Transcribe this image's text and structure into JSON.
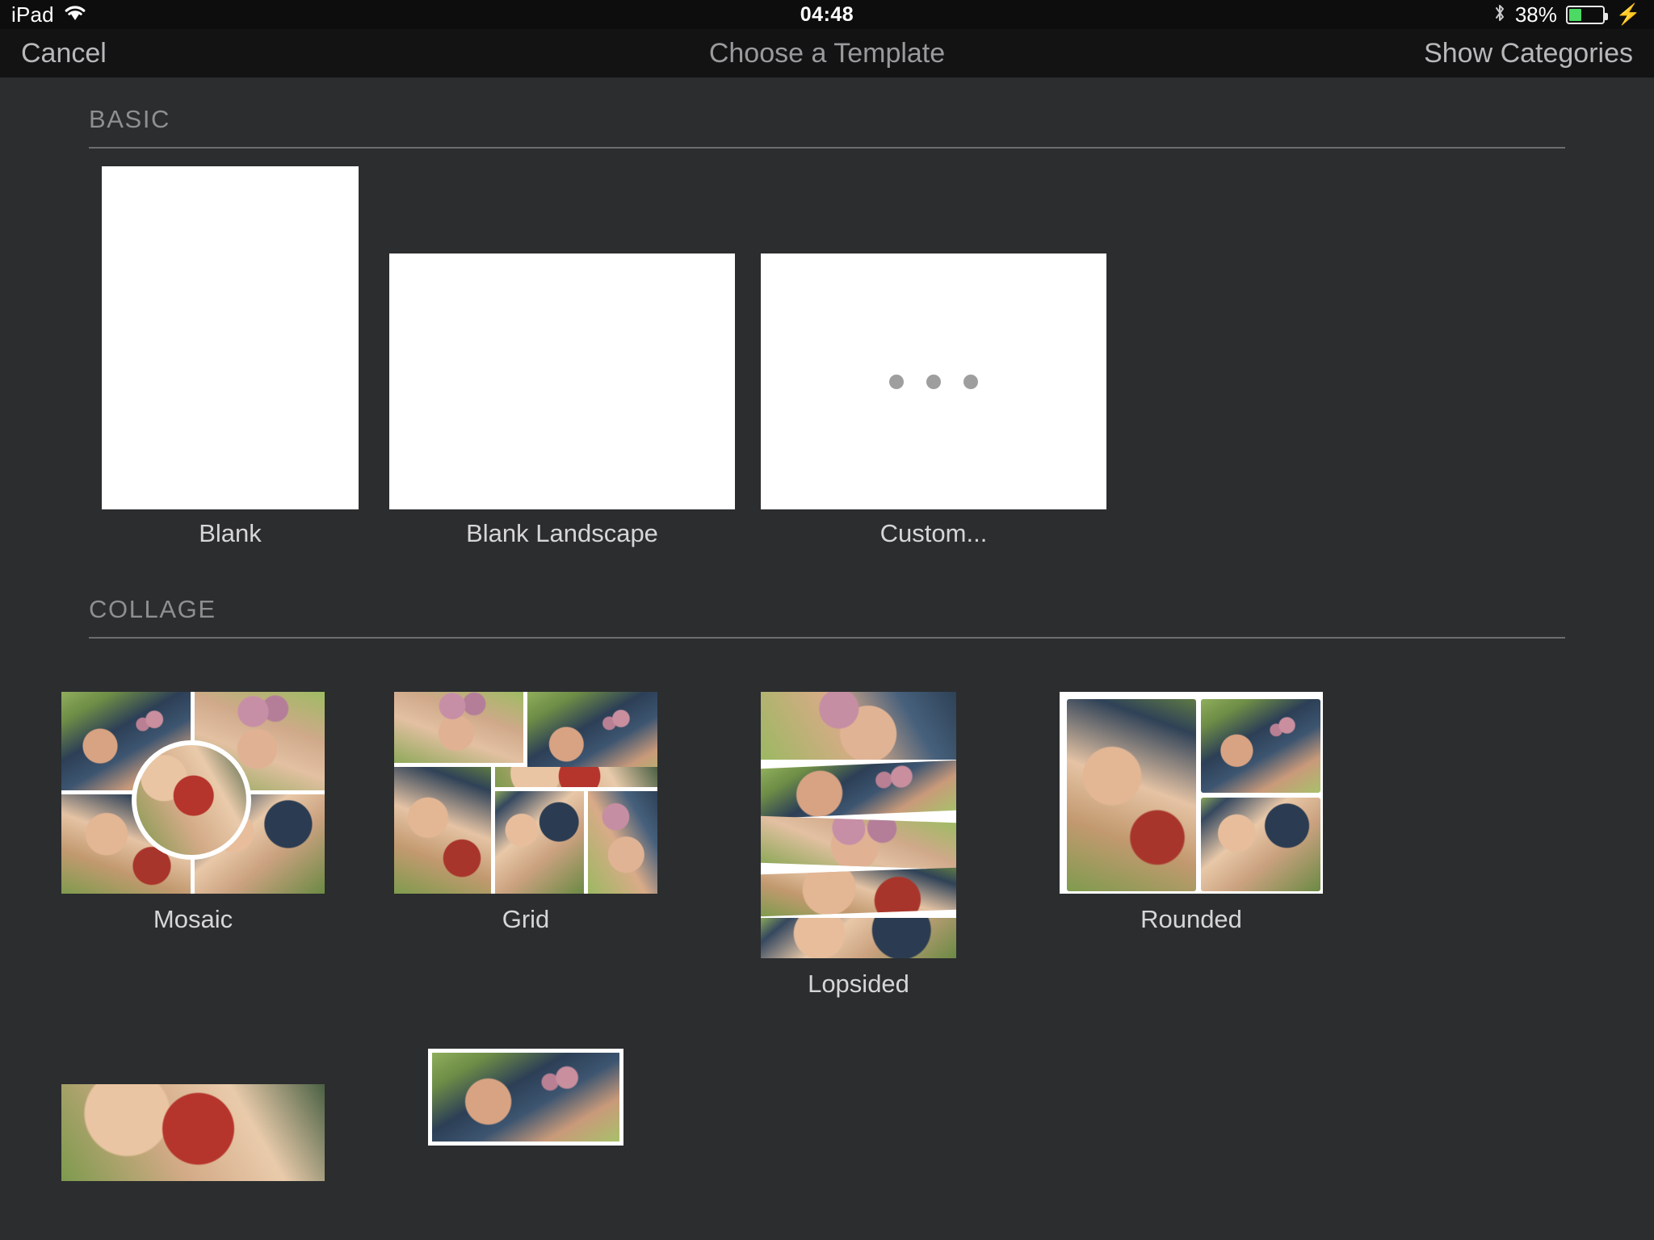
{
  "statusbar": {
    "device": "iPad",
    "wifi_icon": "wifi-icon",
    "time": "04:48",
    "bluetooth_icon": "bluetooth-icon",
    "battery_percent": "38%",
    "battery_level": 38,
    "battery_color": "#4cd964",
    "charging_icon": "lightning-bolt-icon"
  },
  "navbar": {
    "cancel_label": "Cancel",
    "title": "Choose a Template",
    "show_categories_label": "Show Categories"
  },
  "sections": [
    {
      "id": "basic",
      "title": "BASIC",
      "templates": [
        {
          "id": "blank",
          "label": "Blank",
          "kind": "blank-portrait"
        },
        {
          "id": "blank-landscape",
          "label": "Blank Landscape",
          "kind": "blank-landscape"
        },
        {
          "id": "custom",
          "label": "Custom...",
          "kind": "custom-ellipsis",
          "icon": "ellipsis-icon"
        }
      ]
    },
    {
      "id": "collage",
      "title": "COLLAGE",
      "templates": [
        {
          "id": "mosaic",
          "label": "Mosaic",
          "kind": "mosaic"
        },
        {
          "id": "grid",
          "label": "Grid",
          "kind": "grid"
        },
        {
          "id": "lopsided",
          "label": "Lopsided",
          "kind": "lopsided"
        },
        {
          "id": "rounded",
          "label": "Rounded",
          "kind": "rounded"
        }
      ]
    }
  ],
  "colors": {
    "background": "#2b2d2f",
    "navbar": "#131314",
    "statusbar": "#0d0d0e",
    "placeholder": "#ffffff",
    "label_text": "#d6d6d8",
    "section_text": "#8d8f91",
    "rule": "#6b6d6f",
    "nav_text": "#b8b8ba",
    "nav_title_text": "#9a9a9c"
  }
}
